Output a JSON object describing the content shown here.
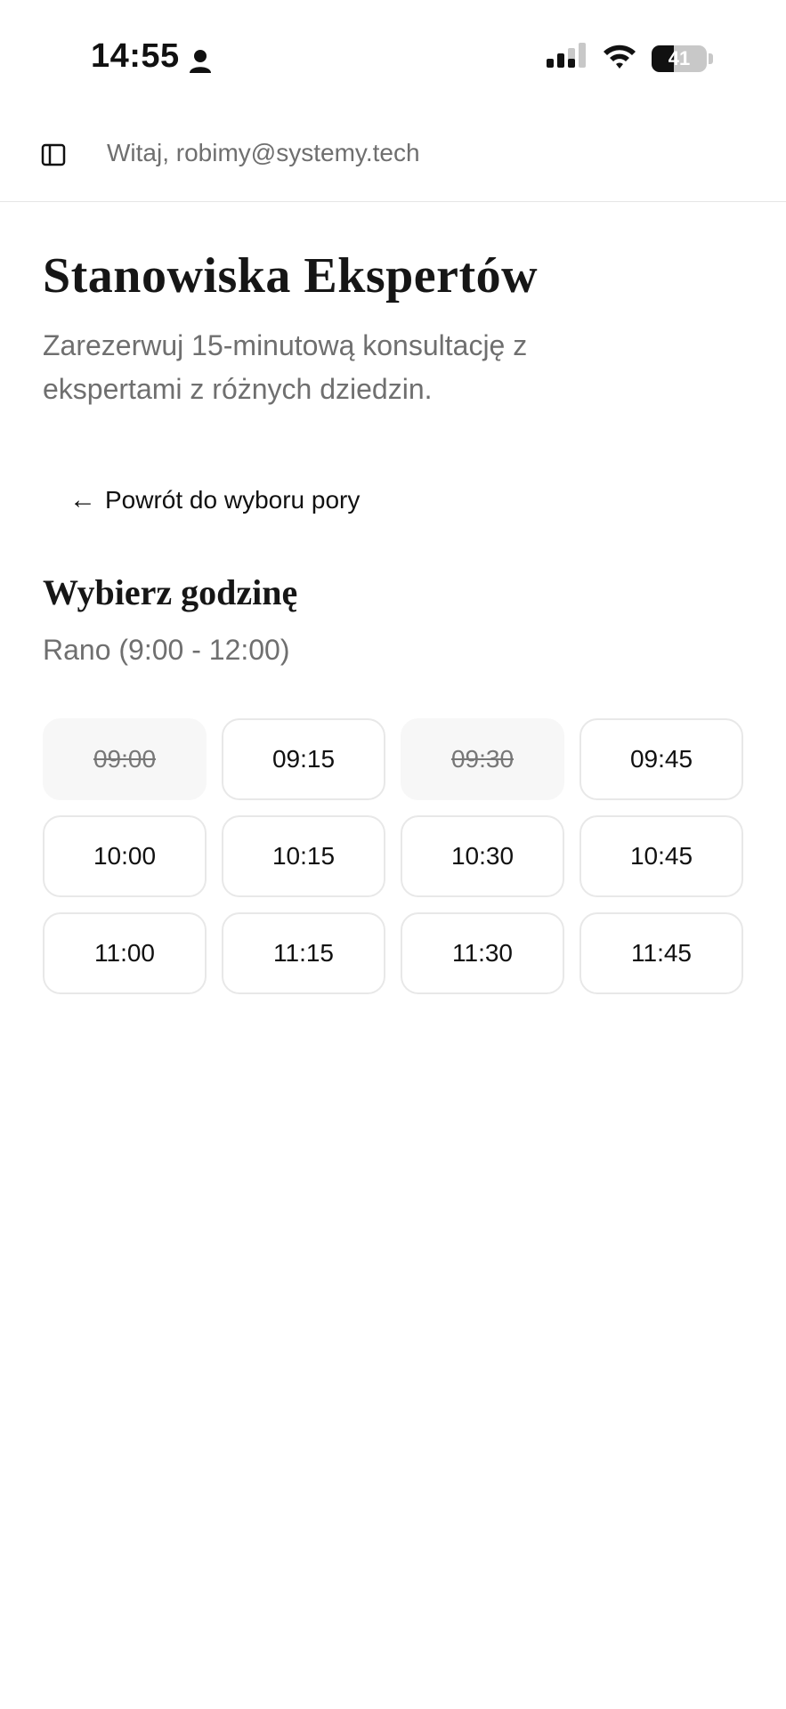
{
  "status_bar": {
    "time": "14:55",
    "battery_level": "41"
  },
  "header": {
    "greeting": "Witaj, robimy@systemy.tech"
  },
  "page": {
    "title": "Stanowiska Ekspertów",
    "subtitle": "Zarezerwuj 15-minutową konsultację z ekspertami z różnych dziedzin."
  },
  "navigation": {
    "back_arrow": "←",
    "back_label": "Powrót do wyboru pory"
  },
  "time_selection": {
    "heading": "Wybierz godzinę",
    "period": "Rano (9:00 - 12:00)",
    "slots": [
      {
        "time": "09:00",
        "available": false
      },
      {
        "time": "09:15",
        "available": true
      },
      {
        "time": "09:30",
        "available": false
      },
      {
        "time": "09:45",
        "available": true
      },
      {
        "time": "10:00",
        "available": true
      },
      {
        "time": "10:15",
        "available": true
      },
      {
        "time": "10:30",
        "available": true
      },
      {
        "time": "10:45",
        "available": true
      },
      {
        "time": "11:00",
        "available": true
      },
      {
        "time": "11:15",
        "available": true
      },
      {
        "time": "11:30",
        "available": true
      },
      {
        "time": "11:45",
        "available": true
      }
    ]
  },
  "icons": {
    "person": "person-icon",
    "signal": "cellular-signal-icon",
    "wifi": "wifi-icon",
    "battery": "battery-icon",
    "sidebar": "sidebar-toggle-icon"
  }
}
